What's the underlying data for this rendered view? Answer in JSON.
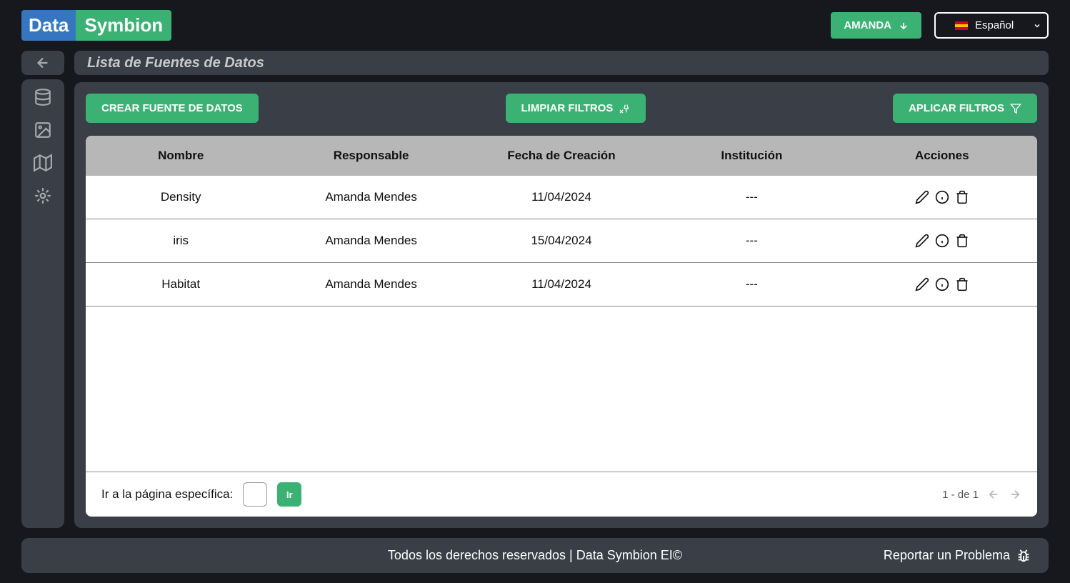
{
  "header": {
    "logo_left": "Data",
    "logo_right": "Symbion",
    "user_label": "AMANDA",
    "language_label": "Español"
  },
  "sidebar": {
    "items": [
      "database",
      "image",
      "map",
      "brain"
    ]
  },
  "page": {
    "title": "Lista de Fuentes de Datos"
  },
  "toolbar": {
    "create_label": "CREAR FUENTE DE DATOS",
    "clear_label": "LIMPIAR FILTROS",
    "apply_label": "APLICAR FILTROS"
  },
  "table": {
    "headers": [
      "Nombre",
      "Responsable",
      "Fecha de Creación",
      "Institución",
      "Acciones"
    ],
    "rows": [
      {
        "nombre": "Density",
        "responsable": "Amanda Mendes",
        "fecha": "11/04/2024",
        "institucion": "---"
      },
      {
        "nombre": "iris",
        "responsable": "Amanda Mendes",
        "fecha": "15/04/2024",
        "institucion": "---"
      },
      {
        "nombre": "Habitat",
        "responsable": "Amanda Mendes",
        "fecha": "11/04/2024",
        "institucion": "---"
      }
    ]
  },
  "pagination": {
    "goto_label": "Ir a la página específica:",
    "go_button": "Ir",
    "page_info": "1 - de 1"
  },
  "footer": {
    "copyright": "Todos los derechos reservados | Data Symbion EI©",
    "report_label": "Reportar un Problema"
  }
}
